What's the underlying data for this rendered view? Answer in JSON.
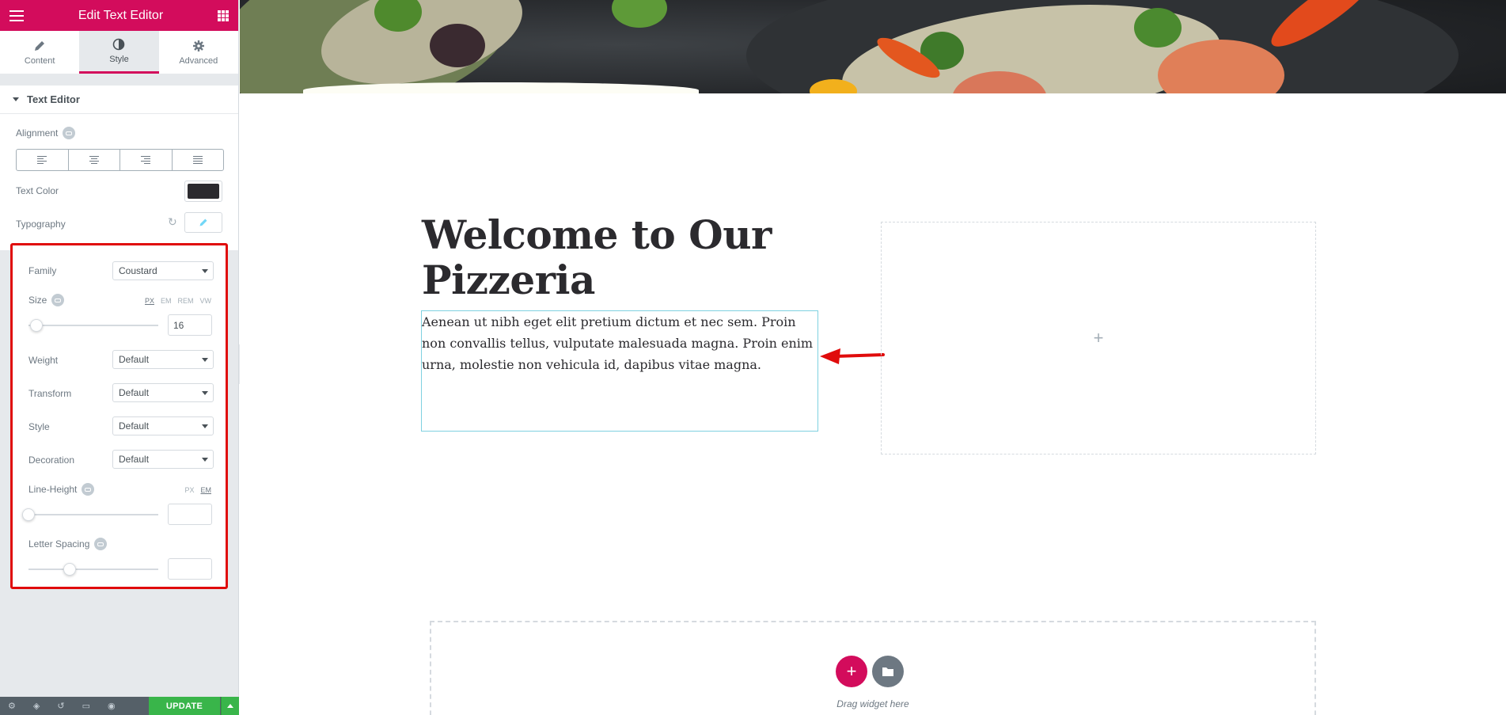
{
  "panel": {
    "title": "Edit Text Editor",
    "tabs": [
      {
        "label": "Content",
        "icon": "pencil-icon"
      },
      {
        "label": "Style",
        "icon": "contrast-icon"
      },
      {
        "label": "Advanced",
        "icon": "gear-icon"
      }
    ],
    "active_tab": "Style",
    "section_title": "Text Editor",
    "alignment_label": "Alignment",
    "alignment_options": [
      "left",
      "center",
      "right",
      "justify"
    ],
    "text_color_label": "Text Color",
    "text_color_value": "#2b2a2e",
    "typography_label": "Typography"
  },
  "typography": {
    "family_label": "Family",
    "family_value": "Coustard",
    "size_label": "Size",
    "size_units": [
      "PX",
      "EM",
      "REM",
      "VW"
    ],
    "size_active_unit": "PX",
    "size_value": "16",
    "weight_label": "Weight",
    "weight_value": "Default",
    "transform_label": "Transform",
    "transform_value": "Default",
    "style_label": "Style",
    "style_value": "Default",
    "decoration_label": "Decoration",
    "decoration_value": "Default",
    "line_height_label": "Line-Height",
    "line_height_units": [
      "PX",
      "EM"
    ],
    "line_height_active_unit": "EM",
    "line_height_value": "",
    "letter_spacing_label": "Letter Spacing",
    "letter_spacing_value": ""
  },
  "footer": {
    "icons": [
      "settings-icon",
      "layers-icon",
      "history-icon",
      "responsive-icon",
      "preview-icon"
    ],
    "update_label": "UPDATE"
  },
  "canvas": {
    "heading": "Welcome to Our Pizzeria",
    "paragraph": "Aenean ut nibh eget elit pretium dictum et nec sem. Proin non convallis tellus, vulputate malesuada magna. Proin enim urna, molestie non vehicula id, dapibus vitae magna.",
    "empty_column_plus": "+",
    "drop_text": "Drag widget here",
    "add_symbol": "+"
  },
  "colors": {
    "brand": "#d30c5c",
    "update_green": "#39b54a",
    "highlight_red": "#e00b0b",
    "selection_blue": "#7fd1e0"
  }
}
